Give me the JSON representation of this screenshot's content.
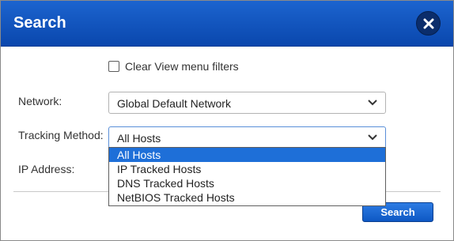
{
  "dialog": {
    "title": "Search",
    "close_icon": "close-icon"
  },
  "form": {
    "clear_filters_label": "Clear View menu filters",
    "clear_filters_checked": false,
    "network_label": "Network:",
    "network_value": "Global Default Network",
    "tracking_label": "Tracking Method:",
    "tracking_value": "All Hosts",
    "ip_label": "IP Address:"
  },
  "tracking_options": [
    {
      "label": "All Hosts",
      "selected": true
    },
    {
      "label": "IP Tracked Hosts",
      "selected": false
    },
    {
      "label": "DNS Tracked Hosts",
      "selected": false
    },
    {
      "label": "NetBIOS Tracked Hosts",
      "selected": false
    }
  ],
  "actions": {
    "search_label": "Search"
  },
  "colors": {
    "titlebar": "#0a47ad",
    "highlight": "#1e6fd8"
  }
}
